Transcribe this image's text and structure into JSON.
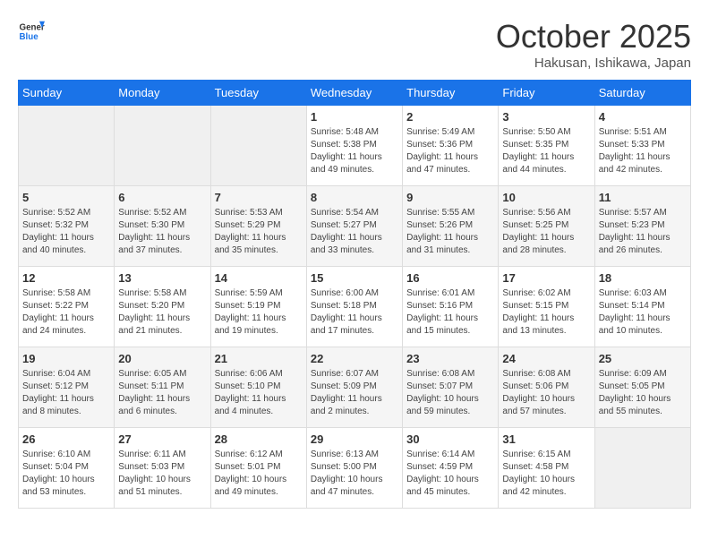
{
  "header": {
    "logo": {
      "line1": "General",
      "line2": "Blue"
    },
    "month": "October 2025",
    "location": "Hakusan, Ishikawa, Japan"
  },
  "days_of_week": [
    "Sunday",
    "Monday",
    "Tuesday",
    "Wednesday",
    "Thursday",
    "Friday",
    "Saturday"
  ],
  "weeks": [
    [
      {
        "num": "",
        "sunrise": "",
        "sunset": "",
        "daylight": ""
      },
      {
        "num": "",
        "sunrise": "",
        "sunset": "",
        "daylight": ""
      },
      {
        "num": "",
        "sunrise": "",
        "sunset": "",
        "daylight": ""
      },
      {
        "num": "1",
        "sunrise": "Sunrise: 5:48 AM",
        "sunset": "Sunset: 5:38 PM",
        "daylight": "Daylight: 11 hours and 49 minutes."
      },
      {
        "num": "2",
        "sunrise": "Sunrise: 5:49 AM",
        "sunset": "Sunset: 5:36 PM",
        "daylight": "Daylight: 11 hours and 47 minutes."
      },
      {
        "num": "3",
        "sunrise": "Sunrise: 5:50 AM",
        "sunset": "Sunset: 5:35 PM",
        "daylight": "Daylight: 11 hours and 44 minutes."
      },
      {
        "num": "4",
        "sunrise": "Sunrise: 5:51 AM",
        "sunset": "Sunset: 5:33 PM",
        "daylight": "Daylight: 11 hours and 42 minutes."
      }
    ],
    [
      {
        "num": "5",
        "sunrise": "Sunrise: 5:52 AM",
        "sunset": "Sunset: 5:32 PM",
        "daylight": "Daylight: 11 hours and 40 minutes."
      },
      {
        "num": "6",
        "sunrise": "Sunrise: 5:52 AM",
        "sunset": "Sunset: 5:30 PM",
        "daylight": "Daylight: 11 hours and 37 minutes."
      },
      {
        "num": "7",
        "sunrise": "Sunrise: 5:53 AM",
        "sunset": "Sunset: 5:29 PM",
        "daylight": "Daylight: 11 hours and 35 minutes."
      },
      {
        "num": "8",
        "sunrise": "Sunrise: 5:54 AM",
        "sunset": "Sunset: 5:27 PM",
        "daylight": "Daylight: 11 hours and 33 minutes."
      },
      {
        "num": "9",
        "sunrise": "Sunrise: 5:55 AM",
        "sunset": "Sunset: 5:26 PM",
        "daylight": "Daylight: 11 hours and 31 minutes."
      },
      {
        "num": "10",
        "sunrise": "Sunrise: 5:56 AM",
        "sunset": "Sunset: 5:25 PM",
        "daylight": "Daylight: 11 hours and 28 minutes."
      },
      {
        "num": "11",
        "sunrise": "Sunrise: 5:57 AM",
        "sunset": "Sunset: 5:23 PM",
        "daylight": "Daylight: 11 hours and 26 minutes."
      }
    ],
    [
      {
        "num": "12",
        "sunrise": "Sunrise: 5:58 AM",
        "sunset": "Sunset: 5:22 PM",
        "daylight": "Daylight: 11 hours and 24 minutes."
      },
      {
        "num": "13",
        "sunrise": "Sunrise: 5:58 AM",
        "sunset": "Sunset: 5:20 PM",
        "daylight": "Daylight: 11 hours and 21 minutes."
      },
      {
        "num": "14",
        "sunrise": "Sunrise: 5:59 AM",
        "sunset": "Sunset: 5:19 PM",
        "daylight": "Daylight: 11 hours and 19 minutes."
      },
      {
        "num": "15",
        "sunrise": "Sunrise: 6:00 AM",
        "sunset": "Sunset: 5:18 PM",
        "daylight": "Daylight: 11 hours and 17 minutes."
      },
      {
        "num": "16",
        "sunrise": "Sunrise: 6:01 AM",
        "sunset": "Sunset: 5:16 PM",
        "daylight": "Daylight: 11 hours and 15 minutes."
      },
      {
        "num": "17",
        "sunrise": "Sunrise: 6:02 AM",
        "sunset": "Sunset: 5:15 PM",
        "daylight": "Daylight: 11 hours and 13 minutes."
      },
      {
        "num": "18",
        "sunrise": "Sunrise: 6:03 AM",
        "sunset": "Sunset: 5:14 PM",
        "daylight": "Daylight: 11 hours and 10 minutes."
      }
    ],
    [
      {
        "num": "19",
        "sunrise": "Sunrise: 6:04 AM",
        "sunset": "Sunset: 5:12 PM",
        "daylight": "Daylight: 11 hours and 8 minutes."
      },
      {
        "num": "20",
        "sunrise": "Sunrise: 6:05 AM",
        "sunset": "Sunset: 5:11 PM",
        "daylight": "Daylight: 11 hours and 6 minutes."
      },
      {
        "num": "21",
        "sunrise": "Sunrise: 6:06 AM",
        "sunset": "Sunset: 5:10 PM",
        "daylight": "Daylight: 11 hours and 4 minutes."
      },
      {
        "num": "22",
        "sunrise": "Sunrise: 6:07 AM",
        "sunset": "Sunset: 5:09 PM",
        "daylight": "Daylight: 11 hours and 2 minutes."
      },
      {
        "num": "23",
        "sunrise": "Sunrise: 6:08 AM",
        "sunset": "Sunset: 5:07 PM",
        "daylight": "Daylight: 10 hours and 59 minutes."
      },
      {
        "num": "24",
        "sunrise": "Sunrise: 6:08 AM",
        "sunset": "Sunset: 5:06 PM",
        "daylight": "Daylight: 10 hours and 57 minutes."
      },
      {
        "num": "25",
        "sunrise": "Sunrise: 6:09 AM",
        "sunset": "Sunset: 5:05 PM",
        "daylight": "Daylight: 10 hours and 55 minutes."
      }
    ],
    [
      {
        "num": "26",
        "sunrise": "Sunrise: 6:10 AM",
        "sunset": "Sunset: 5:04 PM",
        "daylight": "Daylight: 10 hours and 53 minutes."
      },
      {
        "num": "27",
        "sunrise": "Sunrise: 6:11 AM",
        "sunset": "Sunset: 5:03 PM",
        "daylight": "Daylight: 10 hours and 51 minutes."
      },
      {
        "num": "28",
        "sunrise": "Sunrise: 6:12 AM",
        "sunset": "Sunset: 5:01 PM",
        "daylight": "Daylight: 10 hours and 49 minutes."
      },
      {
        "num": "29",
        "sunrise": "Sunrise: 6:13 AM",
        "sunset": "Sunset: 5:00 PM",
        "daylight": "Daylight: 10 hours and 47 minutes."
      },
      {
        "num": "30",
        "sunrise": "Sunrise: 6:14 AM",
        "sunset": "Sunset: 4:59 PM",
        "daylight": "Daylight: 10 hours and 45 minutes."
      },
      {
        "num": "31",
        "sunrise": "Sunrise: 6:15 AM",
        "sunset": "Sunset: 4:58 PM",
        "daylight": "Daylight: 10 hours and 42 minutes."
      },
      {
        "num": "",
        "sunrise": "",
        "sunset": "",
        "daylight": ""
      }
    ]
  ]
}
